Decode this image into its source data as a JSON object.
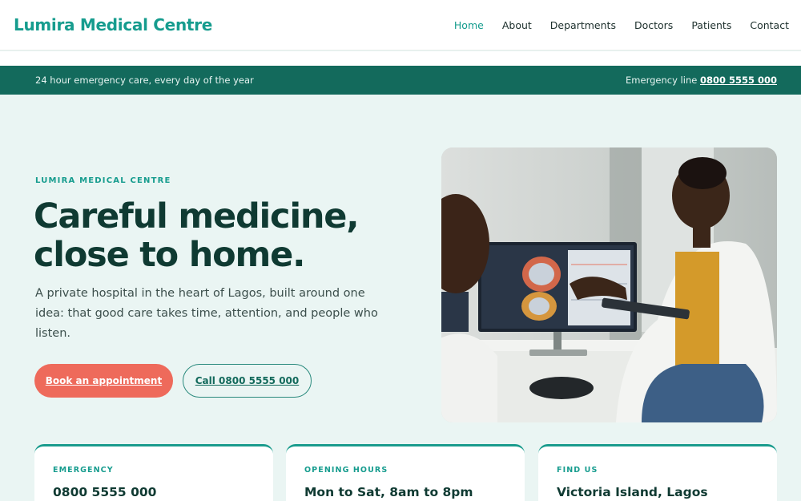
{
  "header": {
    "brand": "Lumira Medical Centre",
    "nav": [
      {
        "label": "Home",
        "active": true
      },
      {
        "label": "About",
        "active": false
      },
      {
        "label": "Departments",
        "active": false
      },
      {
        "label": "Doctors",
        "active": false
      },
      {
        "label": "Patients",
        "active": false
      },
      {
        "label": "Contact",
        "active": false
      }
    ]
  },
  "emergency_bar": {
    "tagline": "24 hour emergency care, every day of the year",
    "line_label": "Emergency line",
    "line_number": "0800 5555 000"
  },
  "hero": {
    "eyebrow": "LUMIRA MEDICAL CENTRE",
    "title_line1": "Careful medicine,",
    "title_line2": "close to home.",
    "description": "A private hospital in the heart of Lagos, built around one idea: that good care takes time, attention, and people who listen.",
    "primary_button": "Book an appointment",
    "secondary_button": "Call 0800 5555 000"
  },
  "info_cards": [
    {
      "label": "EMERGENCY",
      "value": "0800 5555 000"
    },
    {
      "label": "OPENING HOURS",
      "value": "Mon to Sat, 8am to 8pm"
    },
    {
      "label": "FIND US",
      "value": "Victoria Island, Lagos"
    }
  ],
  "colors": {
    "brand": "#169c8e",
    "emergency_bar": "#136a5c",
    "primary_button": "#ee6a5b",
    "page_background": "#eaf5f3",
    "heading": "#0f3a32"
  }
}
